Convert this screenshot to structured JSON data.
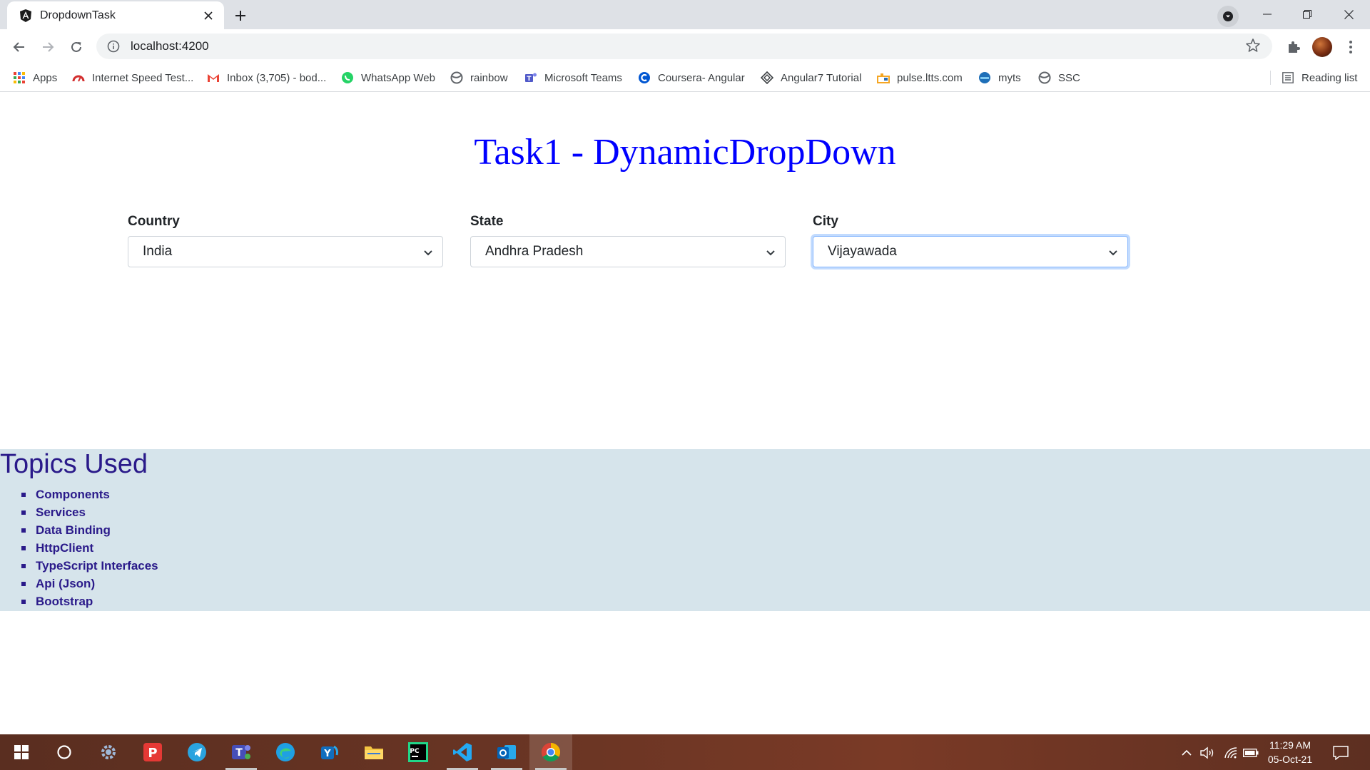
{
  "browser": {
    "tab_title": "DropdownTask",
    "url": "localhost:4200",
    "bookmarks": [
      {
        "label": "Apps",
        "icon": "apps-grid-icon"
      },
      {
        "label": "Internet Speed Test...",
        "icon": "speedometer-icon"
      },
      {
        "label": "Inbox (3,705) - bod...",
        "icon": "gmail-icon"
      },
      {
        "label": "WhatsApp Web",
        "icon": "whatsapp-icon"
      },
      {
        "label": "rainbow",
        "icon": "globe-icon"
      },
      {
        "label": "Microsoft Teams",
        "icon": "teams-icon"
      },
      {
        "label": "Coursera- Angular",
        "icon": "coursera-icon"
      },
      {
        "label": "Angular7 Tutorial",
        "icon": "diamond-icon"
      },
      {
        "label": "pulse.ltts.com",
        "icon": "pulse-icon"
      },
      {
        "label": "myts",
        "icon": "myts-icon"
      },
      {
        "label": "SSC",
        "icon": "globe-icon"
      }
    ],
    "reading_list": "Reading list"
  },
  "page": {
    "title": "Task1 - DynamicDropDown",
    "fields": {
      "country": {
        "label": "Country",
        "value": "India"
      },
      "state": {
        "label": "State",
        "value": "Andhra Pradesh"
      },
      "city": {
        "label": "City",
        "value": "Vijayawada"
      }
    },
    "topics": {
      "title": "Topics Used",
      "items": [
        "Components",
        "Services",
        "Data Binding",
        "HttpClient",
        "TypeScript Interfaces",
        "Api (Json)",
        "Bootstrap"
      ]
    }
  },
  "taskbar": {
    "apps": [
      "windows-start-icon",
      "cortana-search-icon",
      "settings-icon",
      "pocket-icon",
      "telegram-icon",
      "teams-icon",
      "edge-icon",
      "yammer-icon",
      "file-explorer-icon",
      "pycharm-icon",
      "vscode-icon",
      "outlook-icon",
      "chrome-icon"
    ],
    "time": "11:29 AM",
    "date": "05-Oct-21"
  },
  "colors": {
    "title_blue": "#0000ff",
    "topics_bg": "#d6e4eb",
    "topics_text": "#2a1a8a",
    "taskbar_bg": "#6a3524"
  }
}
